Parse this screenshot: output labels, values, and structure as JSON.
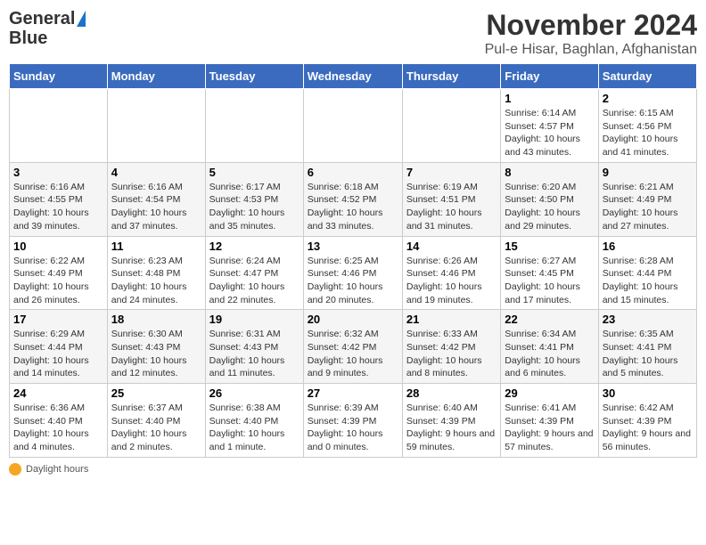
{
  "header": {
    "logo_line1": "General",
    "logo_line2": "Blue",
    "month": "November 2024",
    "location": "Pul-e Hisar, Baghlan, Afghanistan"
  },
  "weekdays": [
    "Sunday",
    "Monday",
    "Tuesday",
    "Wednesday",
    "Thursday",
    "Friday",
    "Saturday"
  ],
  "weeks": [
    [
      {
        "day": "",
        "info": ""
      },
      {
        "day": "",
        "info": ""
      },
      {
        "day": "",
        "info": ""
      },
      {
        "day": "",
        "info": ""
      },
      {
        "day": "",
        "info": ""
      },
      {
        "day": "1",
        "info": "Sunrise: 6:14 AM\nSunset: 4:57 PM\nDaylight: 10 hours and 43 minutes."
      },
      {
        "day": "2",
        "info": "Sunrise: 6:15 AM\nSunset: 4:56 PM\nDaylight: 10 hours and 41 minutes."
      }
    ],
    [
      {
        "day": "3",
        "info": "Sunrise: 6:16 AM\nSunset: 4:55 PM\nDaylight: 10 hours and 39 minutes."
      },
      {
        "day": "4",
        "info": "Sunrise: 6:16 AM\nSunset: 4:54 PM\nDaylight: 10 hours and 37 minutes."
      },
      {
        "day": "5",
        "info": "Sunrise: 6:17 AM\nSunset: 4:53 PM\nDaylight: 10 hours and 35 minutes."
      },
      {
        "day": "6",
        "info": "Sunrise: 6:18 AM\nSunset: 4:52 PM\nDaylight: 10 hours and 33 minutes."
      },
      {
        "day": "7",
        "info": "Sunrise: 6:19 AM\nSunset: 4:51 PM\nDaylight: 10 hours and 31 minutes."
      },
      {
        "day": "8",
        "info": "Sunrise: 6:20 AM\nSunset: 4:50 PM\nDaylight: 10 hours and 29 minutes."
      },
      {
        "day": "9",
        "info": "Sunrise: 6:21 AM\nSunset: 4:49 PM\nDaylight: 10 hours and 27 minutes."
      }
    ],
    [
      {
        "day": "10",
        "info": "Sunrise: 6:22 AM\nSunset: 4:49 PM\nDaylight: 10 hours and 26 minutes."
      },
      {
        "day": "11",
        "info": "Sunrise: 6:23 AM\nSunset: 4:48 PM\nDaylight: 10 hours and 24 minutes."
      },
      {
        "day": "12",
        "info": "Sunrise: 6:24 AM\nSunset: 4:47 PM\nDaylight: 10 hours and 22 minutes."
      },
      {
        "day": "13",
        "info": "Sunrise: 6:25 AM\nSunset: 4:46 PM\nDaylight: 10 hours and 20 minutes."
      },
      {
        "day": "14",
        "info": "Sunrise: 6:26 AM\nSunset: 4:46 PM\nDaylight: 10 hours and 19 minutes."
      },
      {
        "day": "15",
        "info": "Sunrise: 6:27 AM\nSunset: 4:45 PM\nDaylight: 10 hours and 17 minutes."
      },
      {
        "day": "16",
        "info": "Sunrise: 6:28 AM\nSunset: 4:44 PM\nDaylight: 10 hours and 15 minutes."
      }
    ],
    [
      {
        "day": "17",
        "info": "Sunrise: 6:29 AM\nSunset: 4:44 PM\nDaylight: 10 hours and 14 minutes."
      },
      {
        "day": "18",
        "info": "Sunrise: 6:30 AM\nSunset: 4:43 PM\nDaylight: 10 hours and 12 minutes."
      },
      {
        "day": "19",
        "info": "Sunrise: 6:31 AM\nSunset: 4:43 PM\nDaylight: 10 hours and 11 minutes."
      },
      {
        "day": "20",
        "info": "Sunrise: 6:32 AM\nSunset: 4:42 PM\nDaylight: 10 hours and 9 minutes."
      },
      {
        "day": "21",
        "info": "Sunrise: 6:33 AM\nSunset: 4:42 PM\nDaylight: 10 hours and 8 minutes."
      },
      {
        "day": "22",
        "info": "Sunrise: 6:34 AM\nSunset: 4:41 PM\nDaylight: 10 hours and 6 minutes."
      },
      {
        "day": "23",
        "info": "Sunrise: 6:35 AM\nSunset: 4:41 PM\nDaylight: 10 hours and 5 minutes."
      }
    ],
    [
      {
        "day": "24",
        "info": "Sunrise: 6:36 AM\nSunset: 4:40 PM\nDaylight: 10 hours and 4 minutes."
      },
      {
        "day": "25",
        "info": "Sunrise: 6:37 AM\nSunset: 4:40 PM\nDaylight: 10 hours and 2 minutes."
      },
      {
        "day": "26",
        "info": "Sunrise: 6:38 AM\nSunset: 4:40 PM\nDaylight: 10 hours and 1 minute."
      },
      {
        "day": "27",
        "info": "Sunrise: 6:39 AM\nSunset: 4:39 PM\nDaylight: 10 hours and 0 minutes."
      },
      {
        "day": "28",
        "info": "Sunrise: 6:40 AM\nSunset: 4:39 PM\nDaylight: 9 hours and 59 minutes."
      },
      {
        "day": "29",
        "info": "Sunrise: 6:41 AM\nSunset: 4:39 PM\nDaylight: 9 hours and 57 minutes."
      },
      {
        "day": "30",
        "info": "Sunrise: 6:42 AM\nSunset: 4:39 PM\nDaylight: 9 hours and 56 minutes."
      }
    ]
  ],
  "footer": {
    "note": "Daylight hours"
  }
}
